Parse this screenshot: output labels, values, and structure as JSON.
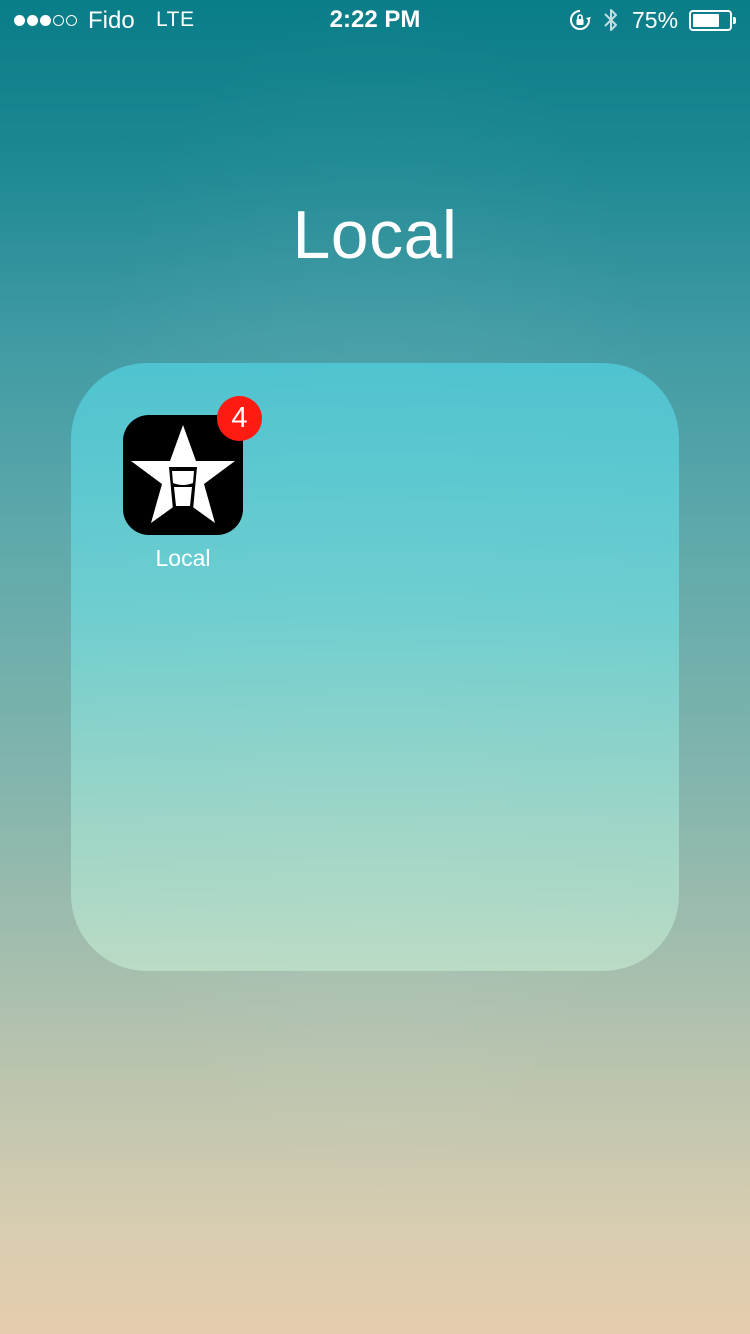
{
  "status_bar": {
    "signal_bars_filled": 3,
    "signal_bars_total": 5,
    "carrier": "Fido",
    "network": "LTE",
    "time": "2:22 PM",
    "rotation_lock_icon": "rotation-lock-icon",
    "bluetooth_icon": "bluetooth-icon",
    "battery_percent_label": "75%",
    "battery_level": 0.75
  },
  "folder": {
    "title": "Local",
    "apps": [
      {
        "label": "Local",
        "icon": "star-pint-icon",
        "badge": "4",
        "badge_color": "#ff1a12"
      }
    ]
  },
  "colors": {
    "wallpaper_top": "#097d88",
    "wallpaper_bottom": "#e6ccae",
    "folder_panel": "#50c6d4"
  }
}
